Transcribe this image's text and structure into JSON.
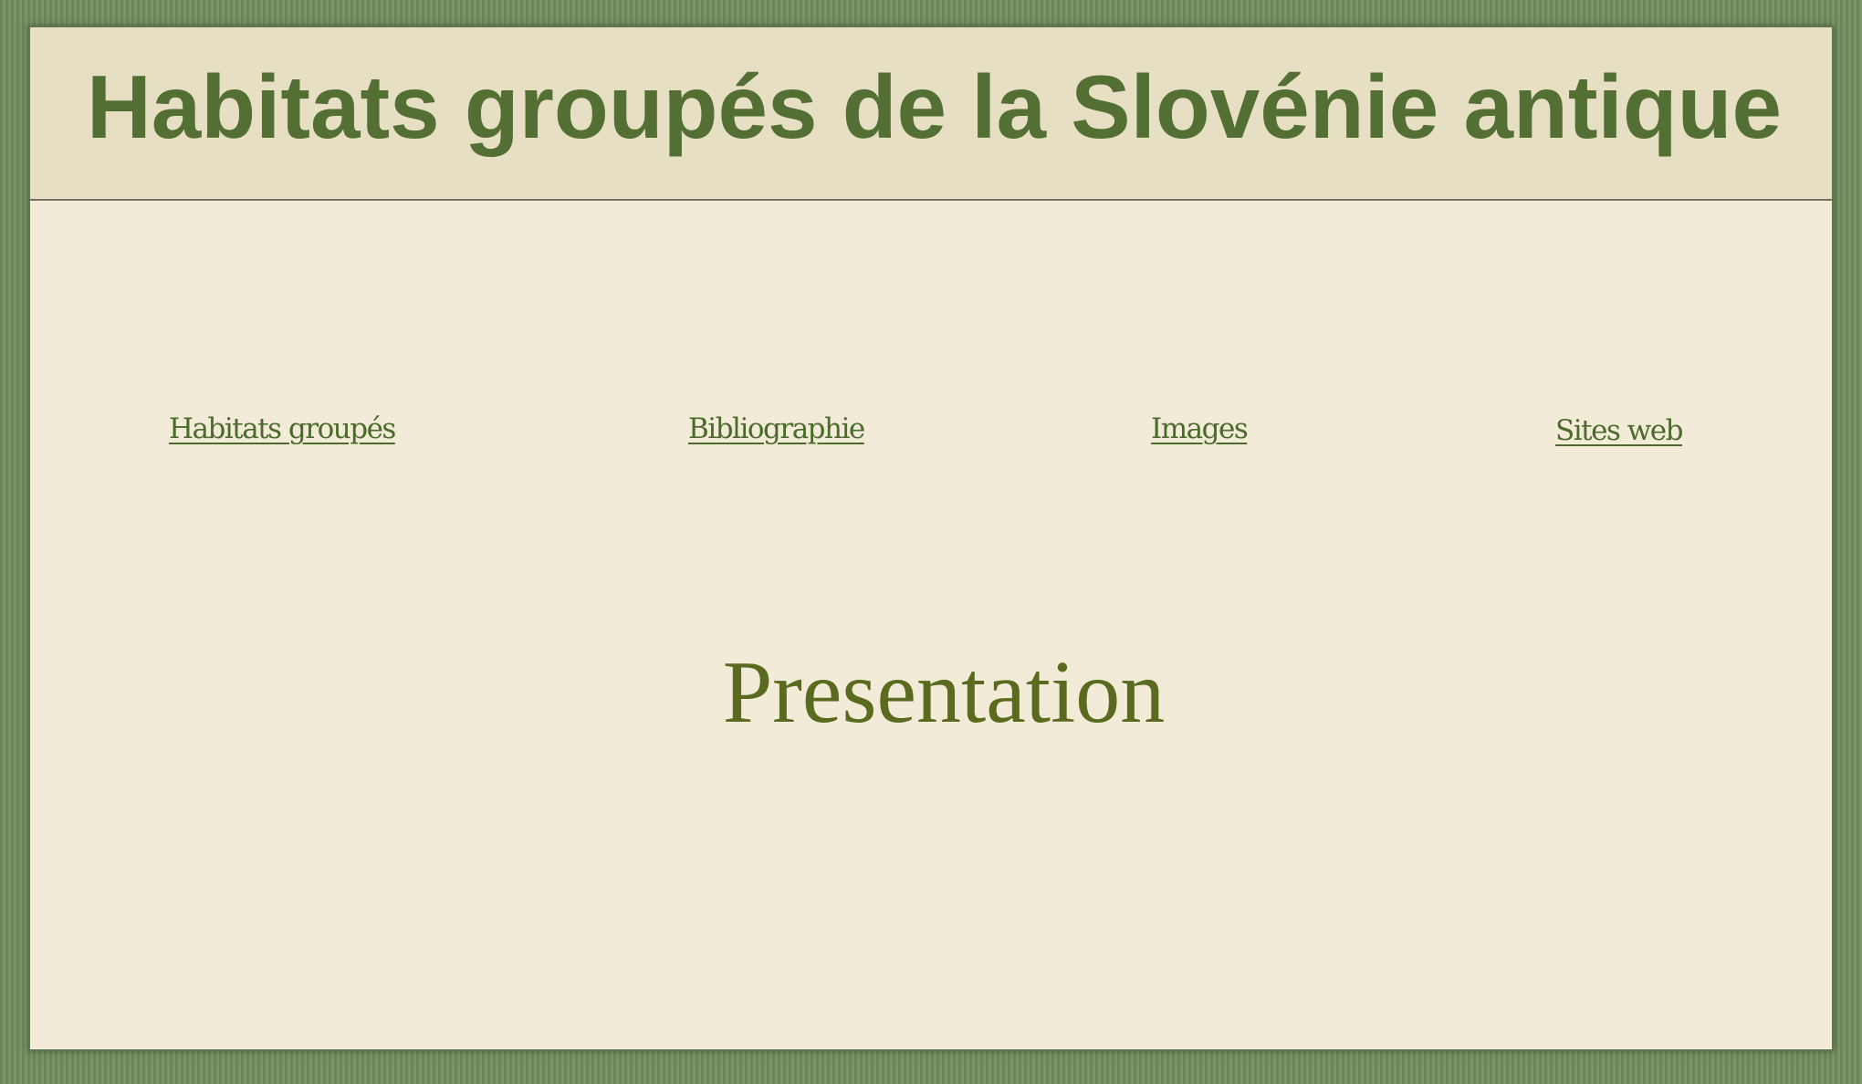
{
  "header": {
    "title": "Habitats groupés de la Slovénie antique"
  },
  "nav": {
    "items": [
      {
        "label": "Habitats groupés"
      },
      {
        "label": "Bibliographie"
      },
      {
        "label": "Images"
      },
      {
        "label": "Sites web"
      }
    ]
  },
  "main": {
    "section_title": "Presentation"
  },
  "colors": {
    "frame": "#6e8a5a",
    "page_background": "#f2ebd7",
    "header_background": "#e7dfc3",
    "title_text": "#536f33",
    "link_text": "#4b6a2c",
    "section_title_text": "#5a6a1e"
  }
}
